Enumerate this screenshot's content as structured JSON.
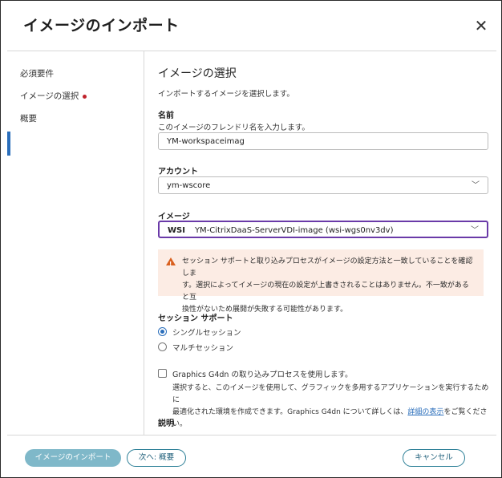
{
  "dialog": {
    "title": "イメージのインポート"
  },
  "sidebar": {
    "items": [
      {
        "label": "必須要件"
      },
      {
        "label": "イメージの選択"
      },
      {
        "label": "概要"
      }
    ]
  },
  "main": {
    "section_title": "イメージの選択",
    "section_desc": "インポートするイメージを選択します。",
    "name": {
      "label": "名前",
      "desc": "このイメージのフレンドリ名を入力します。",
      "value": "YM-workspaceimag"
    },
    "account": {
      "label": "アカウント",
      "value": "ym-wscore"
    },
    "image": {
      "label": "イメージ",
      "badge": "WSI",
      "value": "YM-CitrixDaaS-ServerVDI-image (wsi-wgs0nv3dv)"
    },
    "warning": {
      "line1": "セッション サポートと取り込みプロセスがイメージの設定方法と一致していることを確認しま",
      "line2": "す。選択によってイメージの現在の設定が上書きされることはありません。不一致があると互",
      "line3": "換性がないため展開が失敗する可能性があります。"
    },
    "session": {
      "label": "セッション サポート",
      "options": [
        {
          "label": "シングルセッション",
          "selected": true
        },
        {
          "label": "マルチセッション",
          "selected": false
        }
      ]
    },
    "g4dn": {
      "label": "Graphics G4dn の取り込みプロセスを使用します。",
      "desc1": "選択すると、このイメージを使用して、グラフィックを多用するアプリケーションを実行するために",
      "desc2_pre": "最適化された環境を作成できます。Graphics G4dn について詳しくは、",
      "desc2_link": "詳細の表示",
      "desc2_post": "をご覧ください。"
    },
    "description_label": "説明"
  },
  "footer": {
    "import_label": "イメージのインポート",
    "next_label": "次へ: 概要",
    "cancel_label": "キャンセル"
  },
  "colors": {
    "accent": "#2a6ebb",
    "active_border": "#6a3aa8",
    "warning_bg": "#fcece4",
    "warning_icon": "#d9601f",
    "required_dot": "#c0232c"
  }
}
